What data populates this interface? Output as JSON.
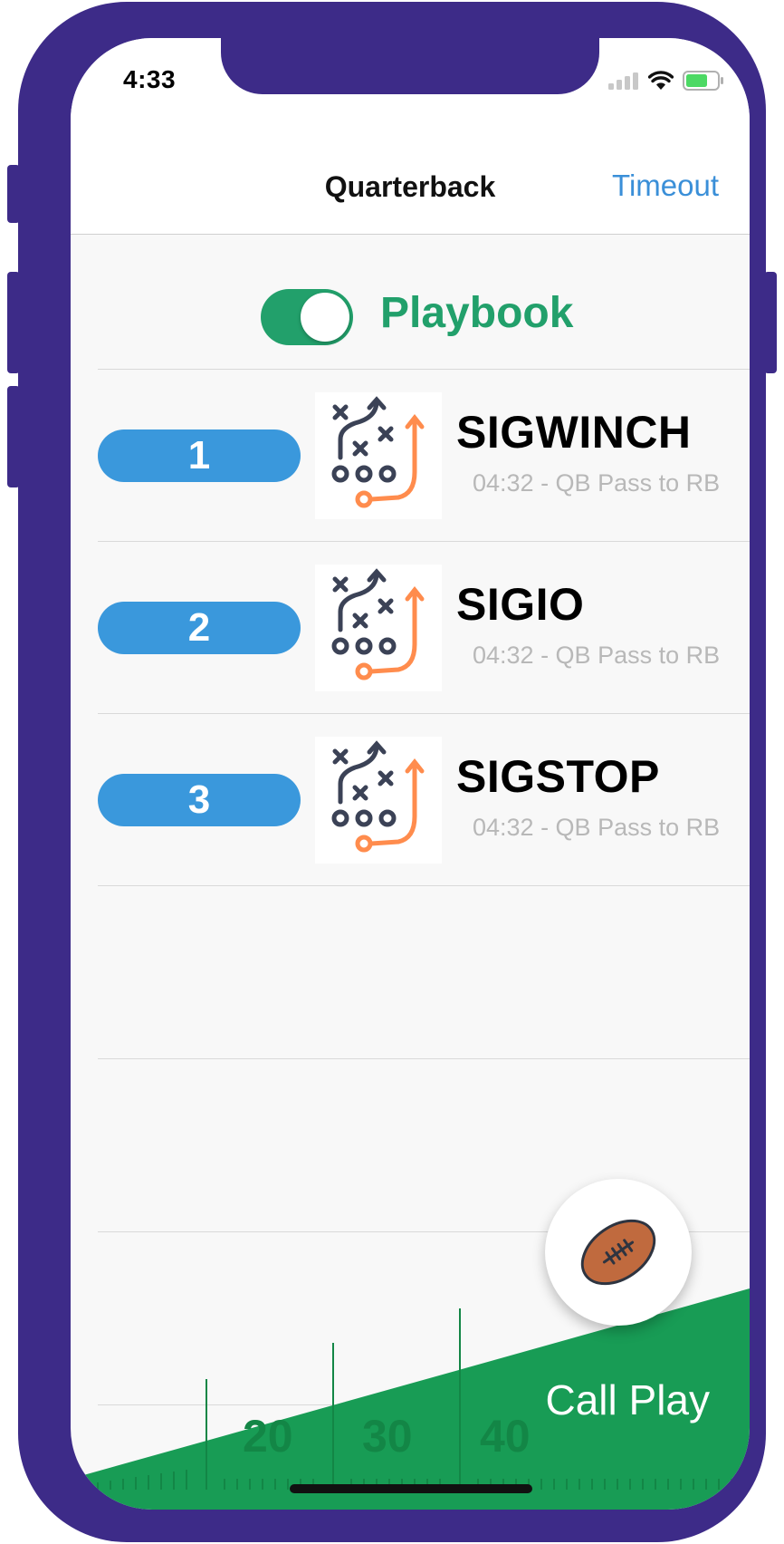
{
  "status_bar": {
    "time": "4:33",
    "icons": [
      "cellular-icon",
      "wifi-icon",
      "battery-icon"
    ]
  },
  "nav": {
    "title": "Quarterback",
    "right_action": "Timeout"
  },
  "playbook_toggle": {
    "label": "Playbook",
    "on": true
  },
  "plays": [
    {
      "number": "1",
      "name": "SIGWINCH",
      "detail": "04:32 - QB Pass to RB",
      "icon": "play-diagram-icon"
    },
    {
      "number": "2",
      "name": "SIGIO",
      "detail": "04:32 - QB Pass to RB",
      "icon": "play-diagram-icon"
    },
    {
      "number": "3",
      "name": "SIGSTOP",
      "detail": "04:32 - QB Pass to RB",
      "icon": "play-diagram-icon"
    }
  ],
  "field_markings": [
    "20",
    "30",
    "40"
  ],
  "call_play": {
    "label": "Call Play",
    "icon": "football-icon"
  },
  "colors": {
    "frame": "#3d2b88",
    "accent_green": "#22a06b",
    "pill_blue": "#3a98dc",
    "link_blue": "#3a8fd8",
    "field_green": "#189c55"
  }
}
